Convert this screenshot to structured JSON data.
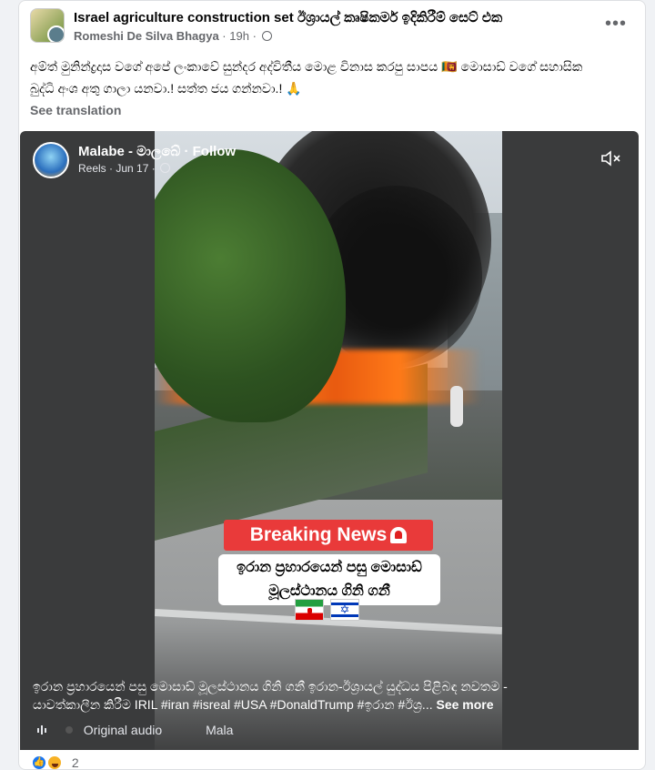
{
  "post": {
    "group_name": "Israel agriculture construction set ඊශ්‍රායල් කෘෂිකර්ම ඉදිකිරීම් සෙට් එක",
    "author": "Romeshi De Silva Bhagya",
    "time": "19h",
    "privacy_icon": "globe-icon",
    "more_icon": "more-options-icon",
    "text_line1": "අම්ත් මුනින්ද්‍රදාස වගේ අපේ ලංකාවේ සුන්දර අද්විතීය මොළ විනාස කරපු සාපය 🇱🇰 මොසාඩ් වගේ සහාසික",
    "text_line2": "බුද්ධි අංශ අතු ගාලා යනවා.! සත්ත ජය ගන්නවා.! 🙏",
    "see_translation": "See translation"
  },
  "reel": {
    "page_name": "Malabe - මාලබේ",
    "follow_label": "Follow",
    "source": "Reels",
    "date": "Jun 17",
    "mute_icon": "muted-speaker-icon",
    "breaking_label": "Breaking News",
    "siren_icon": "siren-icon",
    "overlay_line1": "ඉරාන ප්‍රහාරයෙන් පසු මොසාඩ්",
    "overlay_line2": "මූලස්ථානය ගිනි ගනී",
    "flag_left": "iran-flag-icon",
    "flag_right": "israel-flag-icon",
    "caption_line1": "ඉරාන ප්‍රහාරයෙන් පසු මොසාඩ් මූලස්ථානය ගිනි ගනී ඉරාන-ඊශ්‍රායල් යුද්ධය පිළිබඳ නවතම -",
    "caption_line2": "යාවත්කාලීන කිරීම IRIL #iran #isreal #USA #DonaldTrump #ඉරාන #ඊශ්‍ර...",
    "see_more": "See more",
    "audio_label": "Original audio",
    "audio_author": "Mala",
    "audio_icon": "audio-bars-icon"
  },
  "reactions": {
    "count": "2",
    "icons": [
      "like-icon",
      "haha-icon"
    ]
  }
}
